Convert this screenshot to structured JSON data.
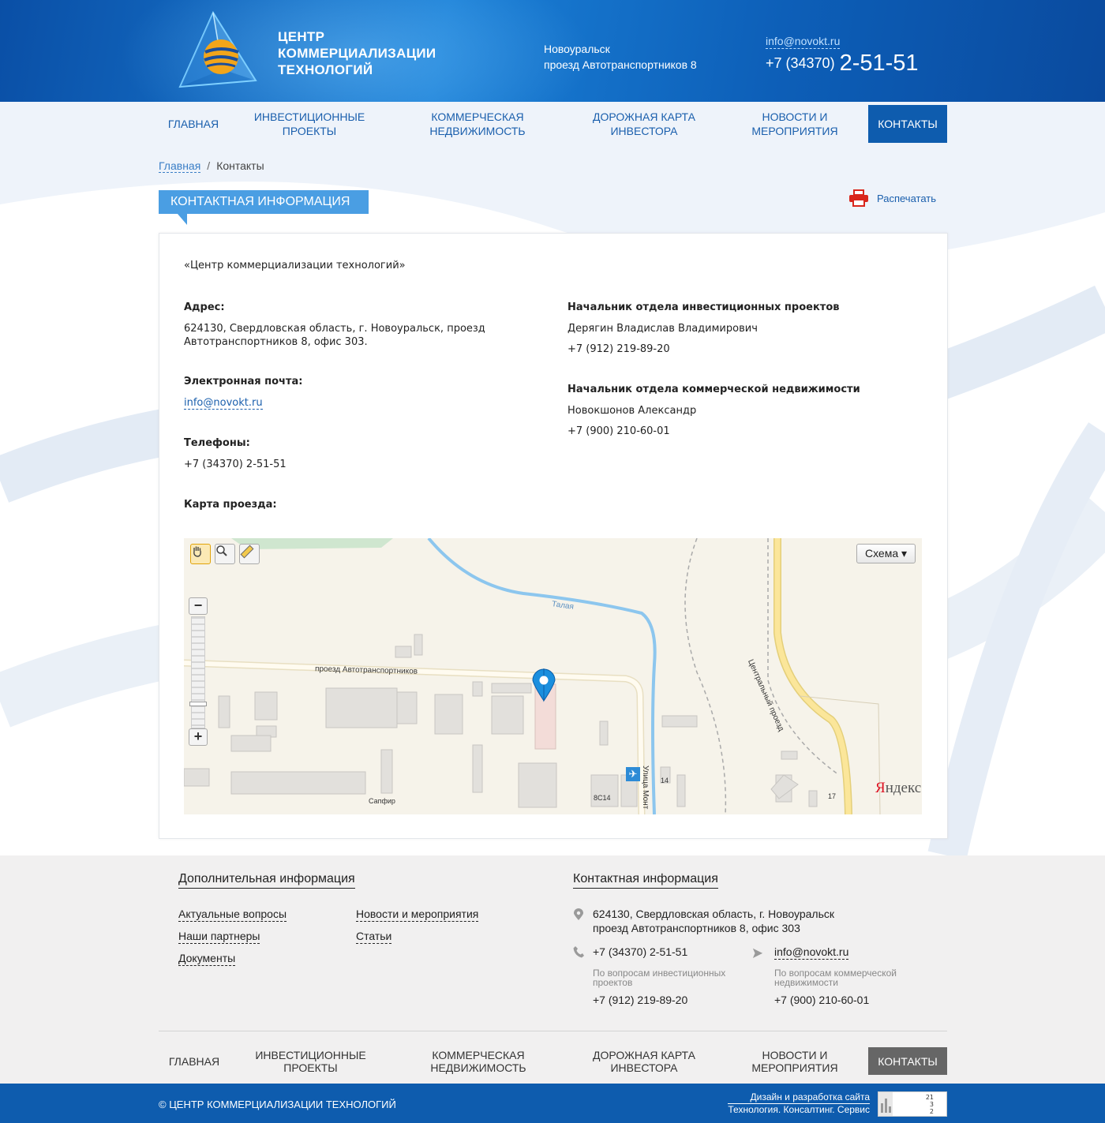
{
  "header": {
    "logo_lines": [
      "ЦЕНТР",
      "КОММЕРЦИАЛИЗАЦИИ",
      "ТЕХНОЛОГИЙ"
    ],
    "address_city": "Новоуральск",
    "address_street": "проезд Автотранспортников 8",
    "email": "info@novokt.ru",
    "phone_code": "+7 (34370)",
    "phone_number": "2-51-51"
  },
  "nav": {
    "items": [
      {
        "label_1": "ГЛАВНАЯ",
        "label_2": ""
      },
      {
        "label_1": "ИНВЕСТИЦИОННЫЕ",
        "label_2": "ПРОЕКТЫ"
      },
      {
        "label_1": "КОММЕРЧЕСКАЯ",
        "label_2": "НЕДВИЖИМОСТЬ"
      },
      {
        "label_1": "ДОРОЖНАЯ КАРТА",
        "label_2": "ИНВЕСТОРА"
      },
      {
        "label_1": "НОВОСТИ И",
        "label_2": "МЕРОПРИЯТИЯ"
      },
      {
        "label_1": "КОНТАКТЫ",
        "label_2": ""
      }
    ],
    "active_index": 5
  },
  "breadcrumb": {
    "home": "Главная",
    "separator": "/",
    "current": "Контакты"
  },
  "section": {
    "title": "КОНТАКТНАЯ ИНФОРМАЦИЯ",
    "print_label": "Распечатать",
    "print_icon": "printer-icon"
  },
  "contacts": {
    "organization": "«Центр коммерциализации технологий»",
    "address_label": "Адрес:",
    "address_line1": "624130, Свердловская область, г. Новоуральск, проезд",
    "address_line2": "Автотранспортников 8, офис 303.",
    "email_label": "Электронная почта:",
    "email": "info@novokt.ru",
    "phones_label": "Телефоны:",
    "phone": "+7 (34370) 2-51-51",
    "map_label": "Карта проезда:",
    "head_invest_title": "Начальник отдела инвестиционных проектов",
    "head_invest_name": "Дерягин Владислав Владимирович",
    "head_invest_phone": "+7 (912) 219-89-20",
    "head_realty_title": "Начальник отдела коммерческой недвижимости",
    "head_realty_name": "Новокшонов Александр",
    "head_realty_phone": "+7 (900) 210-60-01"
  },
  "map": {
    "scheme_label": "Схема ▾",
    "zoom_in": "+",
    "zoom_out": "−",
    "provider_y": "Я",
    "provider_rest": "ндекс",
    "labels": {
      "street_main": "проезд Автотранспортников",
      "river": "Талая",
      "street_central": "Центральный проезд",
      "street_mont": "Улица Монт",
      "sapfir": "Сапфир",
      "bldg_8c14": "8С14",
      "bldg_14": "14",
      "bldg_17": "17"
    },
    "tools": [
      "hand-icon",
      "magnifier-icon",
      "ruler-icon"
    ]
  },
  "footer": {
    "info_title": "Дополнительная информация",
    "links_col1": [
      "Актуальные вопросы",
      "Наши партнеры",
      "Документы"
    ],
    "links_col2": [
      "Новости и мероприятия",
      "Статьи"
    ],
    "contact_title": "Контактная информация",
    "address_line1": "624130, Свердловская область, г. Новоуральск",
    "address_line2": "проезд Автотранспортников 8, офис 303",
    "phone": "+7 (34370) 2-51-51",
    "email": "info@novokt.ru",
    "invest_note_1": "По вопросам инвестиционных",
    "invest_note_2": "проектов",
    "invest_phone": "+7 (912) 219-89-20",
    "realty_note_1": "По вопросам коммерческой",
    "realty_note_2": "недвижимости",
    "realty_phone": "+7 (900) 210-60-01"
  },
  "bottom": {
    "copyright": "© ЦЕНТР КОММЕРЦИАЛИЗАЦИИ ТЕХНОЛОГИЙ",
    "dev_line1": "Дизайн и разработка сайта",
    "dev_line2": "Технология. Консалтинг. Сервис",
    "counter_values": [
      "21",
      "3",
      "2"
    ]
  },
  "colors": {
    "primary": "#0e5cae",
    "accent": "#4a9ee3",
    "link": "#1a5fad",
    "footer_bg": "#f1f0f0"
  }
}
